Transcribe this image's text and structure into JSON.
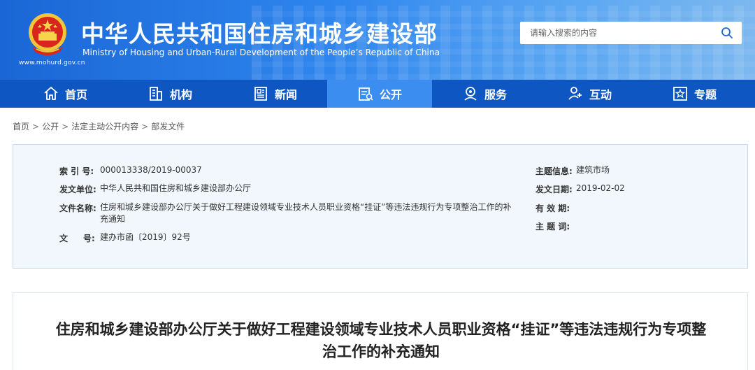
{
  "header": {
    "title": "中华人民共和国住房和城乡建设部",
    "subtitle": "Ministry of Housing and Urban-Rural Development of the People’s Republic of China",
    "url": "www.mohurd.gov.cn",
    "search_placeholder": "请输入搜索的内容",
    "emblem_icon": "national-emblem-icon",
    "search_icon": "search-icon"
  },
  "nav": {
    "items": [
      {
        "label": "首页",
        "icon": "home-icon"
      },
      {
        "label": "机构",
        "icon": "building-icon"
      },
      {
        "label": "新闻",
        "icon": "newspaper-icon"
      },
      {
        "label": "公开",
        "icon": "document-icon",
        "active": true
      },
      {
        "label": "服务",
        "icon": "service-icon"
      },
      {
        "label": "互动",
        "icon": "interaction-icon"
      },
      {
        "label": "专题",
        "icon": "star-icon"
      }
    ]
  },
  "breadcrumb": [
    "首页",
    "公开",
    "法定主动公开内容",
    "部发文件"
  ],
  "info": {
    "index_label": "索 引 号:",
    "index_value": "000013338/2019-00037",
    "issuer_label": "发文单位:",
    "issuer_value": "中华人民共和国住房和城乡建设部办公厅",
    "filename_label": "文件名称:",
    "filename_value": "住房和城乡建设部办公厅关于做好工程建设领域专业技术人员职业资格“挂证”等违法违规行为专项整治工作的补充通知",
    "docno_label_1": "文",
    "docno_label_2": "号:",
    "docno_value": "建办市函〔2019〕92号",
    "topic_label": "主题信息:",
    "topic_value": "建筑市场",
    "date_label": "发文日期:",
    "date_value": "2019-02-02",
    "validity_label": "有 效 期:",
    "keywords_label": "主 题 词:"
  },
  "article": {
    "title": "住房和城乡建设部办公厅关于做好工程建设领域专业技术人员职业资格“挂证”等违法违规行为专项整治工作的补充通知"
  },
  "colors": {
    "header_blue": "#1a66d6",
    "nav_blue": "#0e56c2",
    "nav_active": "#3b8df0",
    "panel_bg": "#f2f7fd",
    "panel_border": "#c7daf0"
  }
}
